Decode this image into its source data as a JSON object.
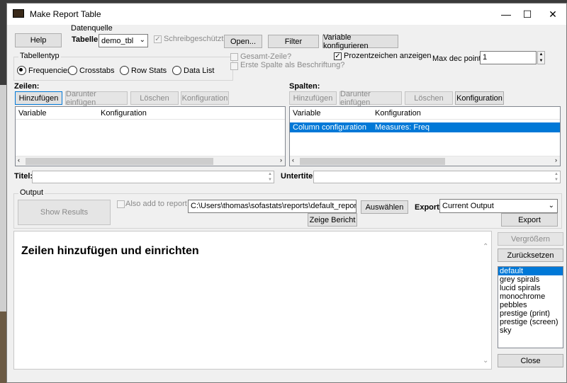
{
  "window": {
    "title": "Make Report Table",
    "minimize": "—",
    "maximize": "☐",
    "close": "✕"
  },
  "datasource": {
    "group_label": "Datenquelle",
    "table_label": "Tabelle:",
    "table_value": "demo_tbl",
    "readonly_label": "Schreibgeschützt",
    "open_label": "Open...",
    "filter_label": "Filter",
    "config_var_label": "Variable konfigurieren"
  },
  "help_label": "Help",
  "tabletype": {
    "label": "Tabellentyp",
    "options": [
      "Frequencies",
      "Crosstabs",
      "Row Stats",
      "Data List"
    ],
    "selected": "Frequencies"
  },
  "options": {
    "total_row": "Gesamt-Zeile?",
    "first_col_label": "Erste Spalte als Beschriftung?",
    "show_percent": "Prozentzeichen anzeigen",
    "max_dec_label": "Max dec points",
    "max_dec_value": "1"
  },
  "rows": {
    "label": "Zeilen:",
    "add": "Hinzufügen",
    "insert_under": "Darunter einfügen",
    "delete": "Löschen",
    "config": "Konfiguration",
    "col_variable": "Variable",
    "col_config": "Konfiguration"
  },
  "cols": {
    "label": "Spalten:",
    "add": "Hinzufügen",
    "insert_under": "Darunter einfügen",
    "delete": "Löschen",
    "config": "Konfiguration",
    "col_variable": "Variable",
    "col_config": "Konfiguration",
    "row_variable": "Column configuration",
    "row_config": "Measures: Freq"
  },
  "titles": {
    "title_label": "Titel:",
    "subtitle_label": "Untertitel:"
  },
  "output": {
    "group_label": "Output",
    "show_results": "Show Results",
    "add_to_report": "Also add to report",
    "path": "C:\\Users\\thomas\\sofastats\\reports\\default_report.htm",
    "browse": "Auswählen",
    "show_report": "Zeige Bericht",
    "export_label": "Export:",
    "export_value": "Current Output",
    "export_button": "Export"
  },
  "preview": {
    "message": "Zeilen hinzufügen und einrichten"
  },
  "side": {
    "enlarge": "Vergrößern",
    "reset": "Zurücksetzen",
    "close": "Close",
    "styles": [
      "default",
      "grey spirals",
      "lucid spirals",
      "monochrome",
      "pebbles",
      "prestige (print)",
      "prestige (screen)",
      "sky"
    ],
    "selected_style": "default"
  },
  "colors": {
    "selection": "#0078d7",
    "focus_border": "#0078d7"
  }
}
